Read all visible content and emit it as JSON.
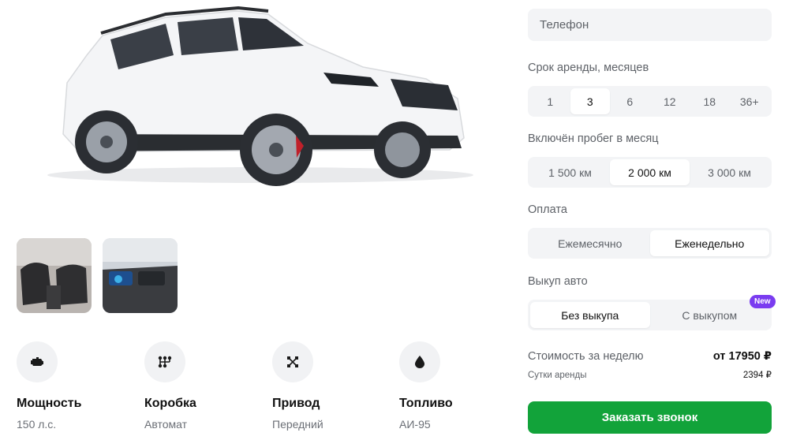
{
  "specs": [
    {
      "icon": "engine-icon",
      "title": "Мощность",
      "value": "150 л.с."
    },
    {
      "icon": "gearbox-icon",
      "title": "Коробка",
      "value": "Автомат"
    },
    {
      "icon": "drivetrain-icon",
      "title": "Привод",
      "value": "Передний"
    },
    {
      "icon": "fuel-drop-icon",
      "title": "Топливо",
      "value": "АИ-95"
    }
  ],
  "form": {
    "phone_placeholder": "Телефон",
    "term": {
      "label": "Срок аренды, месяцев",
      "options": [
        "1",
        "3",
        "6",
        "12",
        "18",
        "36+"
      ],
      "selected": "3"
    },
    "mileage": {
      "label": "Включён пробег в месяц",
      "options": [
        "1 500 км",
        "2 000 км",
        "3 000 км"
      ],
      "selected": "2 000 км"
    },
    "payment": {
      "label": "Оплата",
      "options": [
        "Ежемесячно",
        "Еженедельно"
      ],
      "selected": "Еженедельно"
    },
    "buyout": {
      "label": "Выкуп авто",
      "options": [
        "Без выкупа",
        "С выкупом"
      ],
      "selected": "Без выкупа",
      "badge": "New"
    }
  },
  "pricing": {
    "week_label": "Стоимость за неделю",
    "week_value": "от 17950 ₽",
    "day_label": "Сутки аренды",
    "day_value": "2394 ₽"
  },
  "cta_label": "Заказать звонок",
  "colors": {
    "accent": "#12a33a",
    "badge": "#7a3cf0",
    "field_bg": "#f3f4f6"
  }
}
